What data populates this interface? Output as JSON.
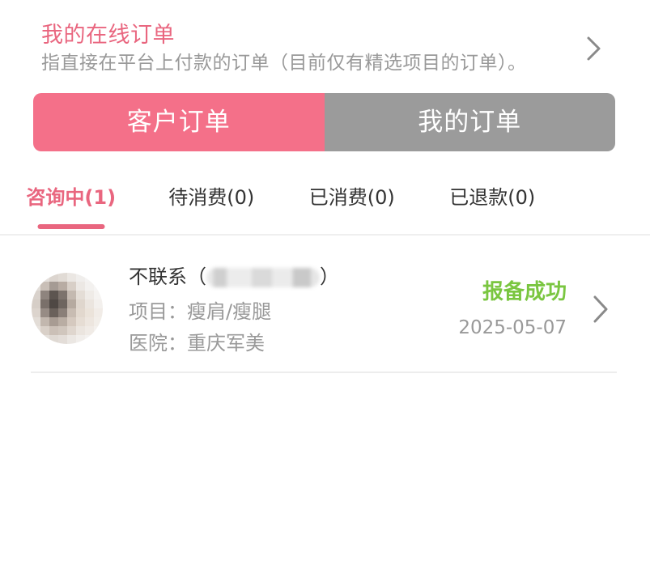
{
  "header": {
    "title": "我的在线订单",
    "subtitle": "指直接在平台上付款的订单（目前仅有精选项目的订单）。",
    "icon": "chevron-right-icon"
  },
  "segmented": {
    "options": [
      {
        "label": "客户订单",
        "active": true
      },
      {
        "label": "我的订单",
        "active": false
      }
    ]
  },
  "tabs": [
    {
      "label": "咨询中(1)",
      "active": true
    },
    {
      "label": "待消费(0)",
      "active": false
    },
    {
      "label": "已消费(0)",
      "active": false
    },
    {
      "label": "已退款(0)",
      "active": false
    }
  ],
  "orders": [
    {
      "name_prefix": "不联系（",
      "name_suffix": "）",
      "project_label": "项目：",
      "project": "瘦肩/瘦腿",
      "hospital_label": "医院：",
      "hospital": "重庆军美",
      "status": "报备成功",
      "date": "2025-05-07",
      "icon": "chevron-right-icon"
    }
  ],
  "colors": {
    "accent_pink": "#E9667F",
    "segment_active": "#F47089",
    "segment_inactive": "#9B9B9B",
    "status_green": "#7AC640",
    "text_dark": "#333333",
    "text_gray": "#999999",
    "divider": "#EDEDED"
  }
}
